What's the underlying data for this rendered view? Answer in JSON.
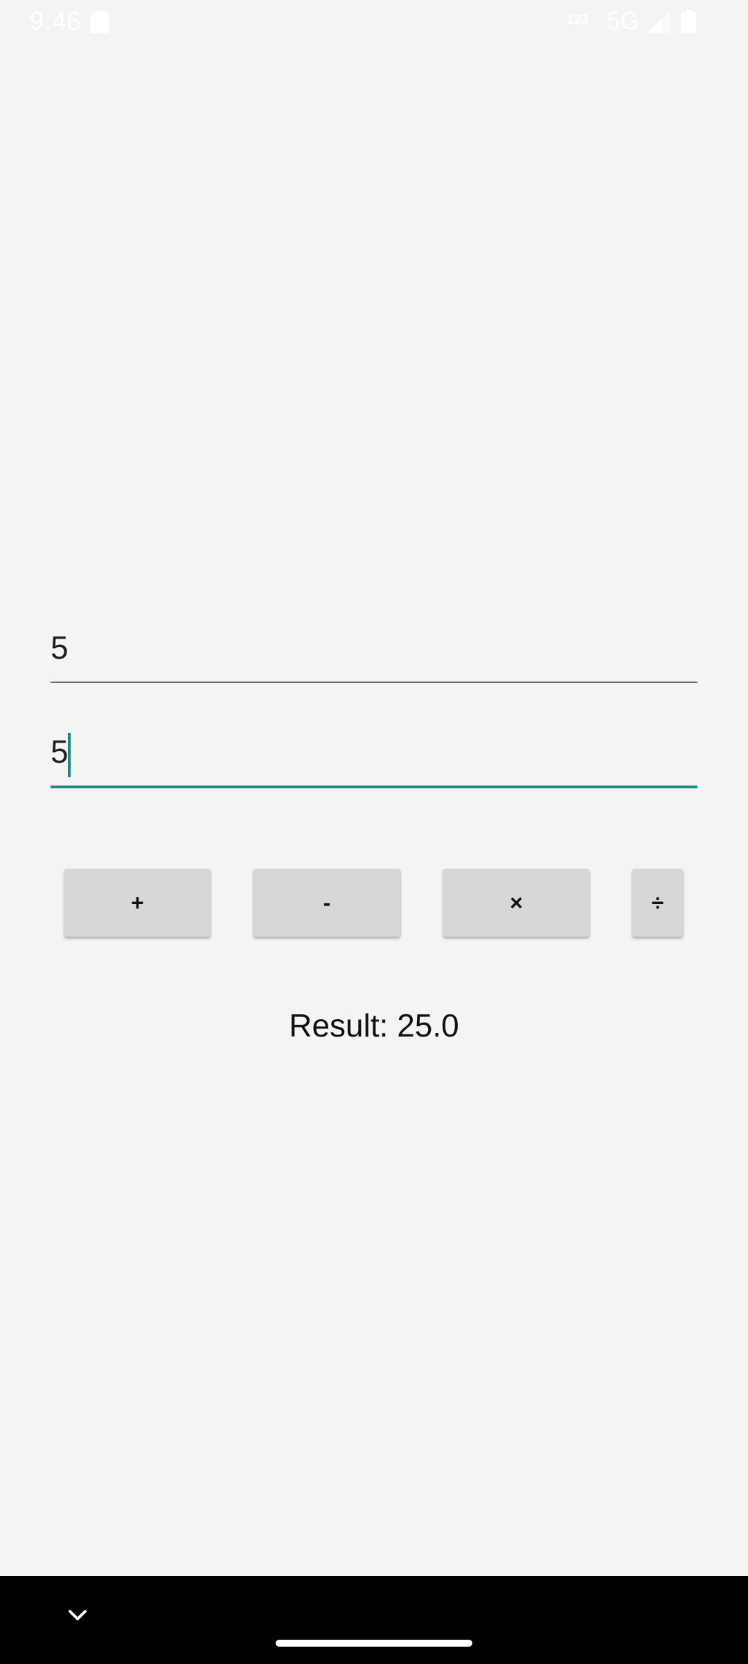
{
  "status_bar": {
    "time": "9:46",
    "keypad_indicator": "123",
    "network_type": "5G",
    "icons": [
      "sd-card-icon",
      "signal-icon",
      "battery-icon"
    ]
  },
  "inputs": {
    "first_number": "5",
    "second_number": "5"
  },
  "operations": {
    "add_label": "+",
    "subtract_label": "-",
    "multiply_label": "×",
    "divide_label": "÷"
  },
  "result": {
    "text": "Result: 25.0"
  },
  "nav_bar": {
    "icons": [
      "chevron-down-icon",
      "home-handle"
    ]
  },
  "colors": {
    "background": "#f4f4f4",
    "accent": "#178a7d",
    "button": "#d6d7d7",
    "nav_bar": "#000000"
  }
}
